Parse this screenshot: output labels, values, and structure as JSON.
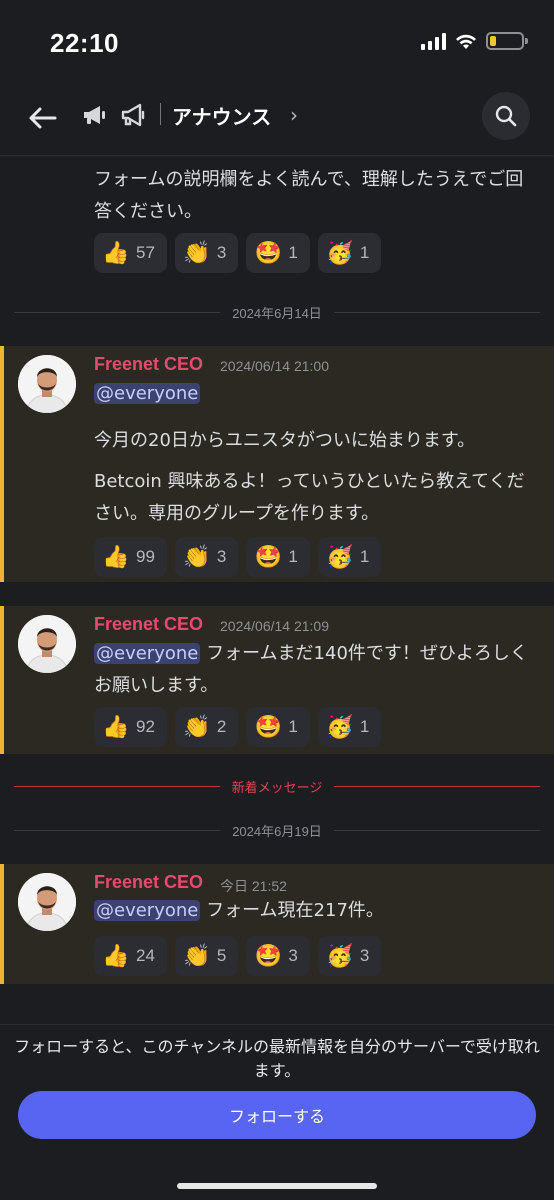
{
  "status": {
    "time": "22:10"
  },
  "header": {
    "channel_title": "アナウンス",
    "chevron": "›"
  },
  "emoji_icons": {
    "thumbs": "👍",
    "clap": "👏",
    "starstruck": "🤩",
    "party": "🥳"
  },
  "messages": [
    {
      "text": "フォームの説明欄をよく読んで、理解したうえでご回答ください。",
      "reactions": [
        {
          "icon": "thumbs",
          "count": "57"
        },
        {
          "icon": "clap",
          "count": "3"
        },
        {
          "icon": "starstruck",
          "count": "1"
        },
        {
          "icon": "party",
          "count": "1"
        }
      ]
    },
    {
      "author": "Freenet CEO",
      "time": "2024/06/14 21:00",
      "mention": "@everyone",
      "line1": "今月の20日からユニスタがついに始まります。",
      "line2": "Betcoin 興味あるよ！っていうひといたら教えてください。専用のグループを作ります。",
      "reactions": [
        {
          "icon": "thumbs",
          "count": "99"
        },
        {
          "icon": "clap",
          "count": "3"
        },
        {
          "icon": "starstruck",
          "count": "1"
        },
        {
          "icon": "party",
          "count": "1"
        }
      ]
    },
    {
      "author": "Freenet CEO",
      "time": "2024/06/14 21:09",
      "mention": "@everyone",
      "text": "フォームまだ140件です！ぜひよろしくお願いします。",
      "reactions": [
        {
          "icon": "thumbs",
          "count": "92"
        },
        {
          "icon": "clap",
          "count": "2"
        },
        {
          "icon": "starstruck",
          "count": "1"
        },
        {
          "icon": "party",
          "count": "1"
        }
      ]
    },
    {
      "author": "Freenet CEO",
      "time": "今日 21:52",
      "mention": "@everyone",
      "text": "フォーム現在217件。",
      "reactions": [
        {
          "icon": "thumbs",
          "count": "24"
        },
        {
          "icon": "clap",
          "count": "5"
        },
        {
          "icon": "starstruck",
          "count": "3"
        },
        {
          "icon": "party",
          "count": "3"
        }
      ]
    }
  ],
  "dividers": {
    "date1": "2024年6月14日",
    "new_messages": "新着メッセージ",
    "date2": "2024年6月19日"
  },
  "footer": {
    "info": "フォローすると、このチャンネルの最新情報を自分のサーバーで受け取れます。",
    "follow_label": "フォローする"
  },
  "colors": {
    "accent": "#5865f2",
    "author": "#e74a6f",
    "new_divider": "#e8424f",
    "highlight_bar": "#f0b232"
  }
}
